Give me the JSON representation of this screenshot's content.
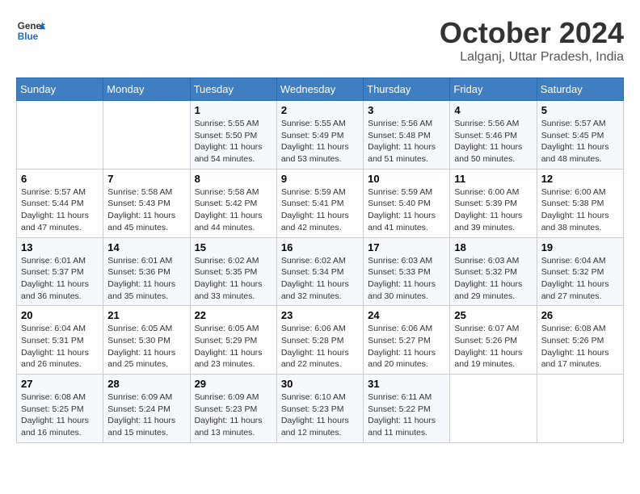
{
  "logo": {
    "general": "General",
    "blue": "Blue"
  },
  "title": "October 2024",
  "location": "Lalganj, Uttar Pradesh, India",
  "headers": [
    "Sunday",
    "Monday",
    "Tuesday",
    "Wednesday",
    "Thursday",
    "Friday",
    "Saturday"
  ],
  "weeks": [
    [
      {
        "day": "",
        "content": ""
      },
      {
        "day": "",
        "content": ""
      },
      {
        "day": "1",
        "content": "Sunrise: 5:55 AM\nSunset: 5:50 PM\nDaylight: 11 hours\nand 54 minutes."
      },
      {
        "day": "2",
        "content": "Sunrise: 5:55 AM\nSunset: 5:49 PM\nDaylight: 11 hours\nand 53 minutes."
      },
      {
        "day": "3",
        "content": "Sunrise: 5:56 AM\nSunset: 5:48 PM\nDaylight: 11 hours\nand 51 minutes."
      },
      {
        "day": "4",
        "content": "Sunrise: 5:56 AM\nSunset: 5:46 PM\nDaylight: 11 hours\nand 50 minutes."
      },
      {
        "day": "5",
        "content": "Sunrise: 5:57 AM\nSunset: 5:45 PM\nDaylight: 11 hours\nand 48 minutes."
      }
    ],
    [
      {
        "day": "6",
        "content": "Sunrise: 5:57 AM\nSunset: 5:44 PM\nDaylight: 11 hours\nand 47 minutes."
      },
      {
        "day": "7",
        "content": "Sunrise: 5:58 AM\nSunset: 5:43 PM\nDaylight: 11 hours\nand 45 minutes."
      },
      {
        "day": "8",
        "content": "Sunrise: 5:58 AM\nSunset: 5:42 PM\nDaylight: 11 hours\nand 44 minutes."
      },
      {
        "day": "9",
        "content": "Sunrise: 5:59 AM\nSunset: 5:41 PM\nDaylight: 11 hours\nand 42 minutes."
      },
      {
        "day": "10",
        "content": "Sunrise: 5:59 AM\nSunset: 5:40 PM\nDaylight: 11 hours\nand 41 minutes."
      },
      {
        "day": "11",
        "content": "Sunrise: 6:00 AM\nSunset: 5:39 PM\nDaylight: 11 hours\nand 39 minutes."
      },
      {
        "day": "12",
        "content": "Sunrise: 6:00 AM\nSunset: 5:38 PM\nDaylight: 11 hours\nand 38 minutes."
      }
    ],
    [
      {
        "day": "13",
        "content": "Sunrise: 6:01 AM\nSunset: 5:37 PM\nDaylight: 11 hours\nand 36 minutes."
      },
      {
        "day": "14",
        "content": "Sunrise: 6:01 AM\nSunset: 5:36 PM\nDaylight: 11 hours\nand 35 minutes."
      },
      {
        "day": "15",
        "content": "Sunrise: 6:02 AM\nSunset: 5:35 PM\nDaylight: 11 hours\nand 33 minutes."
      },
      {
        "day": "16",
        "content": "Sunrise: 6:02 AM\nSunset: 5:34 PM\nDaylight: 11 hours\nand 32 minutes."
      },
      {
        "day": "17",
        "content": "Sunrise: 6:03 AM\nSunset: 5:33 PM\nDaylight: 11 hours\nand 30 minutes."
      },
      {
        "day": "18",
        "content": "Sunrise: 6:03 AM\nSunset: 5:32 PM\nDaylight: 11 hours\nand 29 minutes."
      },
      {
        "day": "19",
        "content": "Sunrise: 6:04 AM\nSunset: 5:32 PM\nDaylight: 11 hours\nand 27 minutes."
      }
    ],
    [
      {
        "day": "20",
        "content": "Sunrise: 6:04 AM\nSunset: 5:31 PM\nDaylight: 11 hours\nand 26 minutes."
      },
      {
        "day": "21",
        "content": "Sunrise: 6:05 AM\nSunset: 5:30 PM\nDaylight: 11 hours\nand 25 minutes."
      },
      {
        "day": "22",
        "content": "Sunrise: 6:05 AM\nSunset: 5:29 PM\nDaylight: 11 hours\nand 23 minutes."
      },
      {
        "day": "23",
        "content": "Sunrise: 6:06 AM\nSunset: 5:28 PM\nDaylight: 11 hours\nand 22 minutes."
      },
      {
        "day": "24",
        "content": "Sunrise: 6:06 AM\nSunset: 5:27 PM\nDaylight: 11 hours\nand 20 minutes."
      },
      {
        "day": "25",
        "content": "Sunrise: 6:07 AM\nSunset: 5:26 PM\nDaylight: 11 hours\nand 19 minutes."
      },
      {
        "day": "26",
        "content": "Sunrise: 6:08 AM\nSunset: 5:26 PM\nDaylight: 11 hours\nand 17 minutes."
      }
    ],
    [
      {
        "day": "27",
        "content": "Sunrise: 6:08 AM\nSunset: 5:25 PM\nDaylight: 11 hours\nand 16 minutes."
      },
      {
        "day": "28",
        "content": "Sunrise: 6:09 AM\nSunset: 5:24 PM\nDaylight: 11 hours\nand 15 minutes."
      },
      {
        "day": "29",
        "content": "Sunrise: 6:09 AM\nSunset: 5:23 PM\nDaylight: 11 hours\nand 13 minutes."
      },
      {
        "day": "30",
        "content": "Sunrise: 6:10 AM\nSunset: 5:23 PM\nDaylight: 11 hours\nand 12 minutes."
      },
      {
        "day": "31",
        "content": "Sunrise: 6:11 AM\nSunset: 5:22 PM\nDaylight: 11 hours\nand 11 minutes."
      },
      {
        "day": "",
        "content": ""
      },
      {
        "day": "",
        "content": ""
      }
    ]
  ]
}
